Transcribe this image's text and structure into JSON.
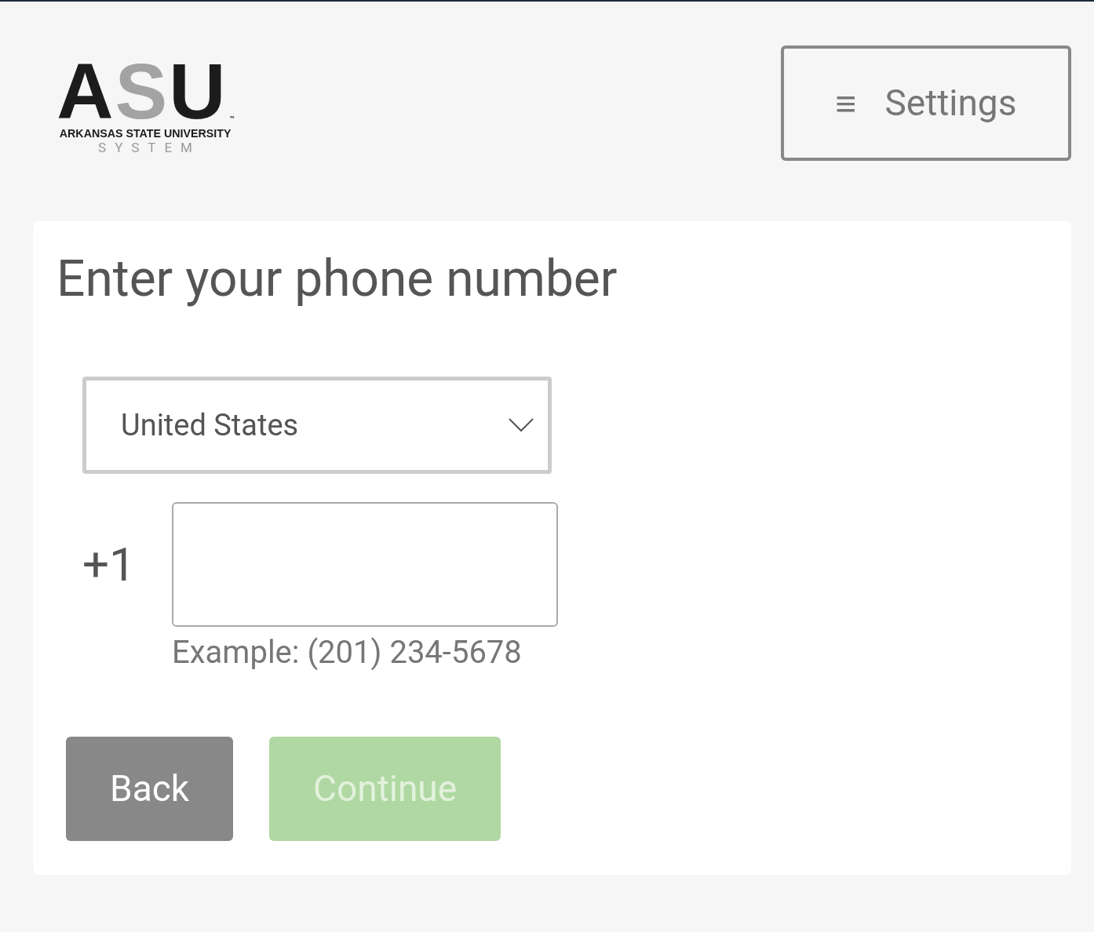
{
  "logo": {
    "letters": [
      {
        "text": "A",
        "color": "#1c1c1c"
      },
      {
        "text": "S",
        "color": "#a3a3a3"
      },
      {
        "text": "U",
        "color": "#1c1c1c"
      }
    ],
    "trademark": "™",
    "name": "ARKANSAS STATE UNIVERSITY",
    "subtitle": "SYSTEM"
  },
  "settings_button": {
    "icon": "≡",
    "label": "Settings"
  },
  "card": {
    "title": "Enter your phone number",
    "country_select": {
      "value": "United States"
    },
    "phone": {
      "prefix": "+1",
      "example": "Example: (201) 234-5678"
    },
    "buttons": [
      {
        "label": "Back",
        "kind": "secondary",
        "disabled": false
      },
      {
        "label": "Continue",
        "kind": "primary",
        "disabled": true
      }
    ]
  }
}
